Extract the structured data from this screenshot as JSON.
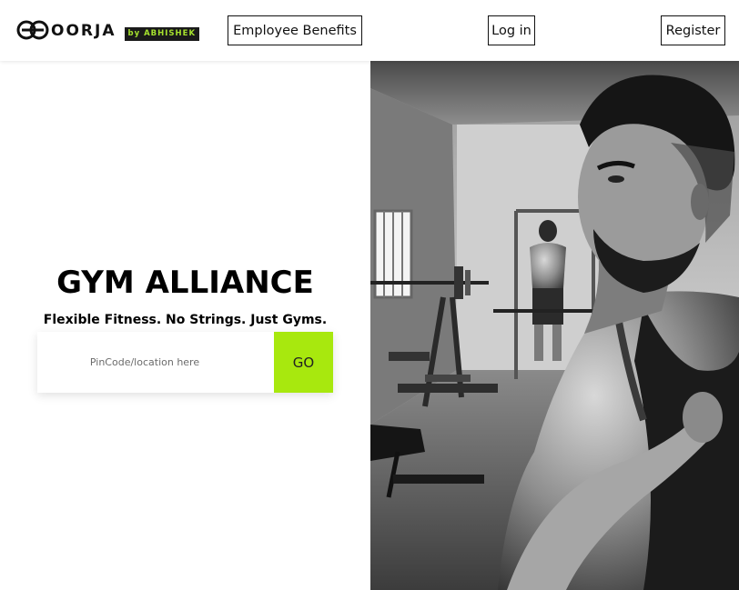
{
  "brand": {
    "name": "OORJA",
    "badge": "by ABHISHEK"
  },
  "nav": {
    "employee_benefits": "Employee Benefits",
    "login": "Log in",
    "register": "Register"
  },
  "hero": {
    "title": "GYM ALLIANCE",
    "subtitle": "Flexible Fitness. No Strings. Just Gyms.",
    "search_placeholder": "PinCode/location here",
    "go_label": "GO"
  },
  "colors": {
    "accent": "#a8e80e",
    "badge_bg": "#1a1a1a",
    "badge_text": "#a6e22e"
  }
}
